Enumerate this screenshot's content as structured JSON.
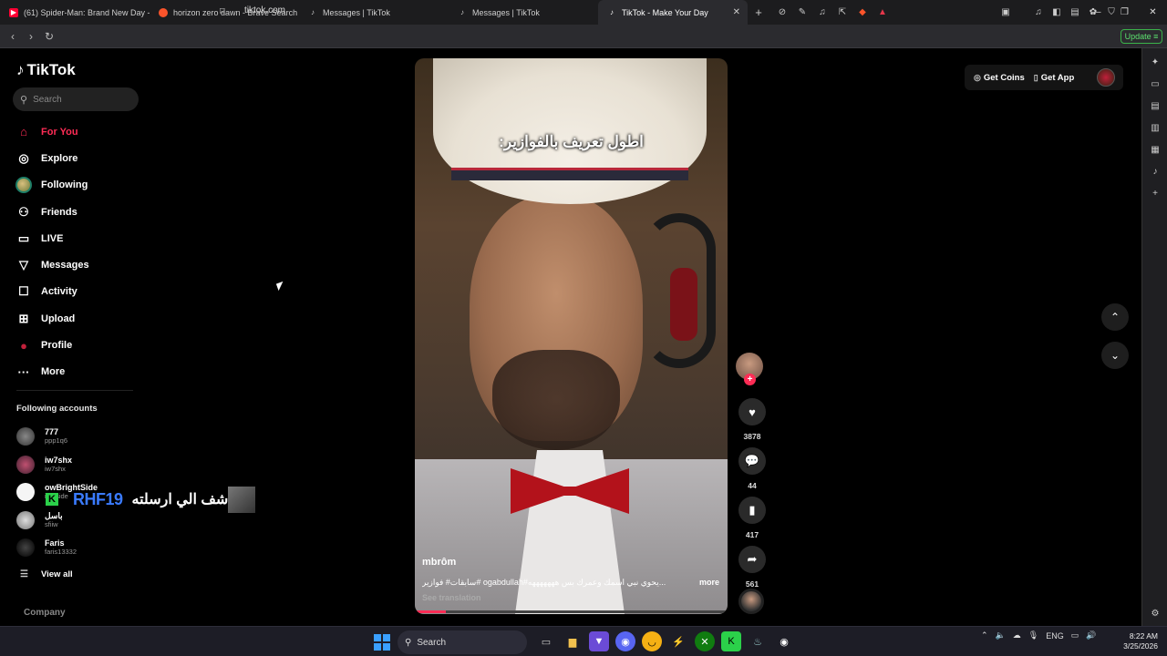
{
  "browser": {
    "tabs": [
      {
        "title": "(61) Spider-Man: Brand New Day - O",
        "icon": "youtube-icon",
        "color": "#ff0033"
      },
      {
        "title": "horizon zero dawn - Brave Search",
        "icon": "brave-search-icon",
        "color": "#fb542b"
      },
      {
        "title": "Messages | TikTok",
        "icon": "tiktok-icon",
        "color": "#ffffff"
      },
      {
        "title": "Messages | TikTok",
        "icon": "tiktok-icon",
        "color": "#ffffff"
      },
      {
        "title": "TikTok - Make Your Day",
        "icon": "tiktok-icon",
        "color": "#ffffff",
        "active": true
      }
    ],
    "url": "tiktok.com",
    "update_label": "Update"
  },
  "tiktok": {
    "logo_text": "TikTok",
    "search_placeholder": "Search",
    "nav": [
      {
        "label": "For You",
        "icon": "home-icon"
      },
      {
        "label": "Explore",
        "icon": "compass-icon"
      },
      {
        "label": "Following",
        "icon": "following-avatar"
      },
      {
        "label": "Friends",
        "icon": "friends-icon"
      },
      {
        "label": "LIVE",
        "icon": "live-icon"
      },
      {
        "label": "Messages",
        "icon": "send-icon"
      },
      {
        "label": "Activity",
        "icon": "activity-icon"
      },
      {
        "label": "Upload",
        "icon": "upload-icon"
      },
      {
        "label": "Profile",
        "icon": "profile-icon"
      },
      {
        "label": "More",
        "icon": "more-icon"
      }
    ],
    "following_title": "Following accounts",
    "following": [
      {
        "name": "777",
        "user": "ppp1q6"
      },
      {
        "name": "iw7shx",
        "user": "iw7shx"
      },
      {
        "name": "owBrightSide",
        "user": "ightside"
      },
      {
        "name": "باسل",
        "user": "sfiiw"
      },
      {
        "name": "Faris",
        "user": "faris13332"
      }
    ],
    "view_all": "View all",
    "company": "Company",
    "top_right": {
      "coins": "Get Coins",
      "app": "Get App"
    }
  },
  "overlay": {
    "badge": "K",
    "handle": "RHF19",
    "text": "شف الي ارسلته"
  },
  "video": {
    "caption": "اطول تعريف بالفوازير:",
    "author": "mbrôm",
    "description": "سابقات# فوازير# ogabdullah#يحوي نبي اسمك وعمرك بس هههههههه...",
    "more": "more",
    "translate": "See translation",
    "progress": 0.1,
    "likes": "3878",
    "comments": "44",
    "saves": "417",
    "shares": "561"
  },
  "taskbar": {
    "search": "Search",
    "lang": "ENG",
    "time": "8:22 AM",
    "date": "3/25/2026"
  }
}
